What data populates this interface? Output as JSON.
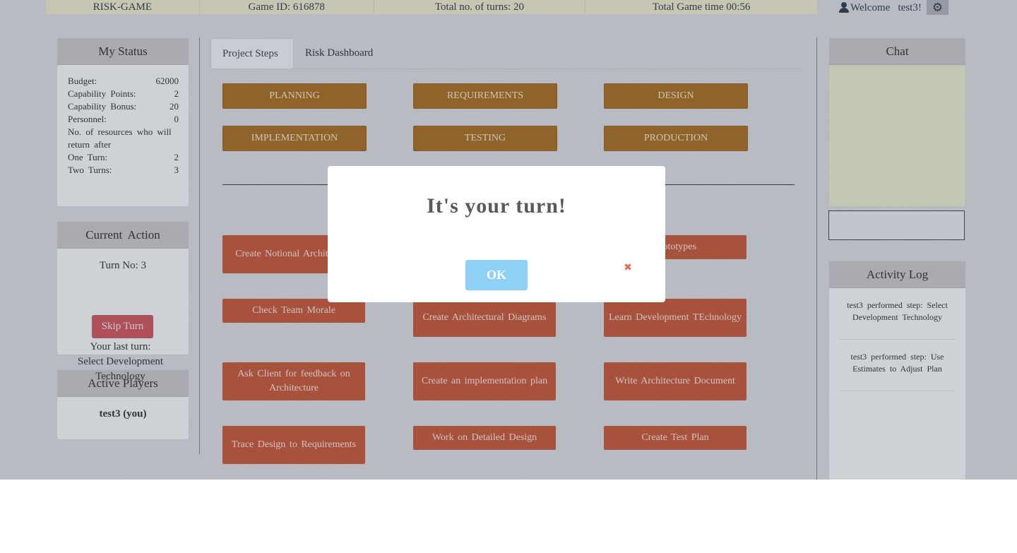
{
  "topbar": {
    "game_name": "RISK-GAME",
    "game_id": "Game ID: 616878",
    "total_turns": "Total no. of turns: 20",
    "total_time": "Total Game time 00:56",
    "welcome": "Welcome   test3!",
    "user_icon": "user-icon",
    "settings_icon": "gear-icon"
  },
  "my_status": {
    "title": "My Status",
    "rows": [
      {
        "label": "Budget:",
        "value": "62000"
      },
      {
        "label": "Capability Points:",
        "value": "2"
      },
      {
        "label": "Capability Bonus:",
        "value": "20"
      },
      {
        "label": "Personnel:",
        "value": "0"
      },
      {
        "label": "No. of resources who will return after",
        "value": ""
      },
      {
        "label": "One Turn:",
        "value": "2"
      },
      {
        "label": "Two Turns:",
        "value": "3"
      }
    ]
  },
  "current_action": {
    "title": "Current Action",
    "turn_no": "Turn No: 3",
    "skip_label": "Skip Turn",
    "last_turn_label": "Your last turn:",
    "last_turn_value": "Select Development Technology"
  },
  "active_players": {
    "title": "Active Players",
    "players": [
      "test3 (you)"
    ]
  },
  "tabs": [
    "Project Steps",
    "Risk Dashboard"
  ],
  "phases": [
    "PLANNING",
    "REQUIREMENTS",
    "DESIGN",
    "IMPLEMENTATION",
    "TESTING",
    "PRODUCTION"
  ],
  "steps": [
    "Create Notional Architecture",
    "",
    "Prototypes",
    "Check Team Morale",
    "Create Architectural Diagrams",
    "Learn Development TEchnology",
    "Ask Client for feedback on Architecture",
    "Create an implementation plan",
    "Write Architecture Document",
    "Trace Design to Requirements",
    "Work on Detailed Design",
    "Create Test Plan"
  ],
  "chat": {
    "title": "Chat",
    "input_value": ""
  },
  "activity_log": {
    "title": "Activity Log",
    "entries": [
      "test3 performed step: Select Development Technology",
      "test3 performed step: Use Estimates to Adjust Plan"
    ]
  },
  "modal": {
    "title": "It's your turn!",
    "ok_label": "OK",
    "close_icon": "close-icon",
    "close_glyph": "✖"
  },
  "colors": {
    "phase_button": "#a0620f",
    "step_button": "#c04a27",
    "skip_button": "#c9484e",
    "ok_button": "#8fd1f4",
    "chat_background": "#e5e4c8"
  }
}
